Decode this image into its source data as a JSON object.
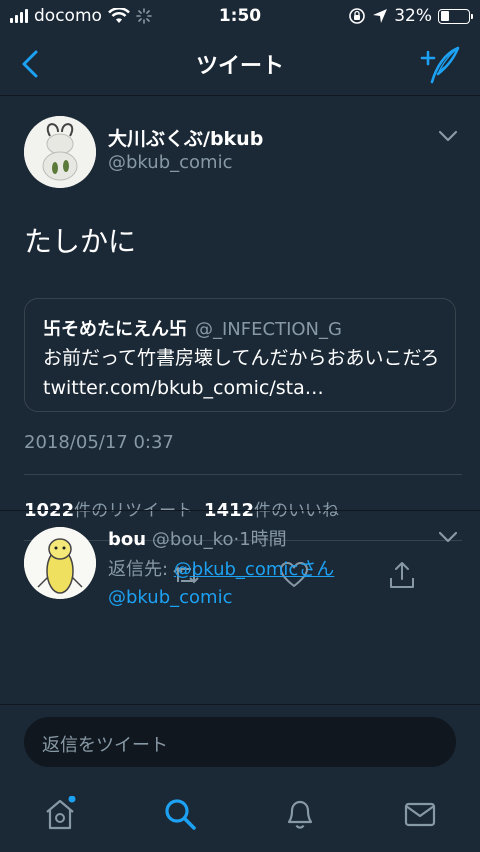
{
  "status_bar": {
    "carrier": "docomo",
    "time": "1:50",
    "battery_percent": "32%",
    "battery_level": 0.32
  },
  "nav": {
    "title": "ツイート",
    "back_icon": "chevron-left-icon",
    "compose_icon": "compose-quill-icon"
  },
  "tweet": {
    "author_name": "大川ぶくぶ/bkub",
    "author_handle": "@bkub_comic",
    "text": "たしかに",
    "quote": {
      "name": "卐そめたにえん卐",
      "handle": "@_INFECTION_G",
      "text": "お前だって竹書房壊してんだからおあいこだろ twitter.com/bkub_comic/sta…"
    },
    "timestamp": "2018/05/17 0:37",
    "retweet_count": "1022",
    "retweet_label": "件のリツイート",
    "like_count": "1412",
    "like_label": "件のいいね"
  },
  "reply": {
    "name": "bou",
    "handle": "@bou_ko",
    "separator": "·",
    "time": "1時間",
    "reply_to_prefix": "返信先: ",
    "reply_to_link": "@bkub_comicさん",
    "body": "@bkub_comic"
  },
  "composer": {
    "placeholder": "返信をツイート"
  },
  "colors": {
    "background": "#1b2836",
    "accent": "#1da1f2",
    "secondary_text": "#8899a6",
    "border": "#38444d"
  }
}
